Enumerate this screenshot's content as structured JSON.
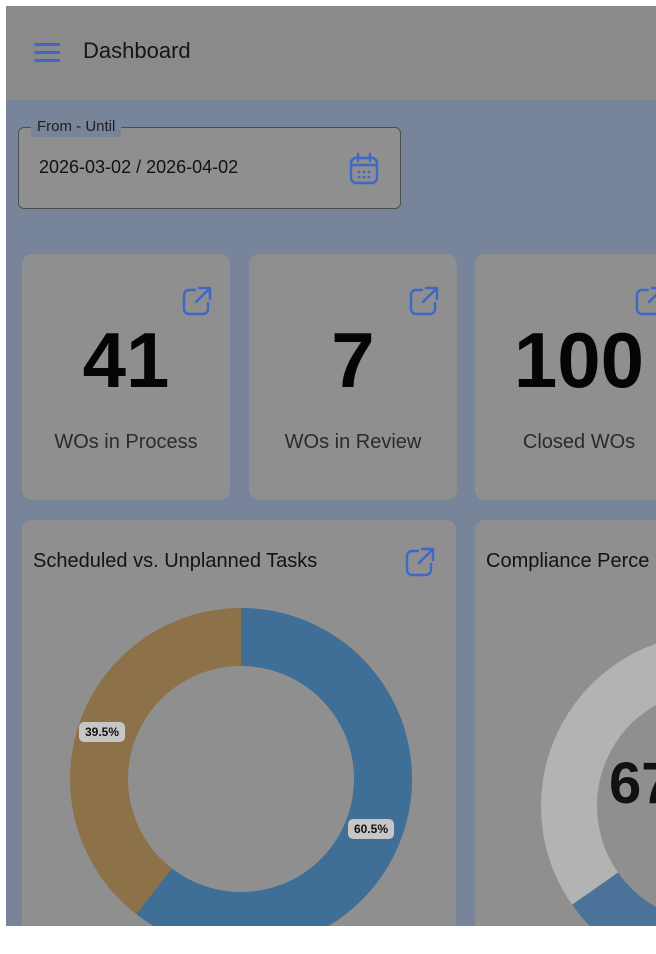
{
  "header": {
    "title": "Dashboard",
    "menu_icon": "menu-icon"
  },
  "date_range": {
    "label": "From - Until",
    "value": "2026-03-02 / 2026-04-02",
    "icon": "calendar-icon"
  },
  "stats": [
    {
      "value": "41",
      "label": "WOs in Process",
      "icon": "external-link-icon"
    },
    {
      "value": "7",
      "label": "WOs in Review",
      "icon": "external-link-icon"
    },
    {
      "value": "100",
      "label": "Closed WOs",
      "icon": "external-link-icon"
    }
  ],
  "scheduled_chart": {
    "title": "Scheduled vs. Unplanned Tasks",
    "chart_data": {
      "type": "pie",
      "slices": [
        {
          "value": 60.5,
          "label": "60.5%",
          "color": "#3f6f96"
        },
        {
          "value": 39.5,
          "label": "39.5%",
          "color": "#8d7149"
        }
      ]
    }
  },
  "compliance_chart": {
    "title": "Compliance Perce",
    "value_text": "67",
    "chart_data": {
      "type": "pie",
      "slices": [
        {
          "value": 67,
          "color": "#4b739a"
        },
        {
          "value": 33,
          "color": "#b3b3b3"
        }
      ]
    }
  },
  "colors": {
    "overlay": "#77849a",
    "topbar": "#8a8a8a",
    "accent": "#3d68c8"
  }
}
